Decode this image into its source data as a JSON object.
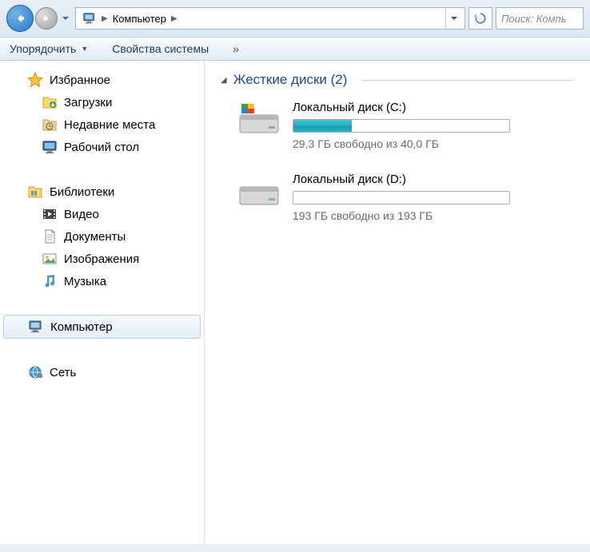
{
  "nav": {
    "location": "Компьютер",
    "search_placeholder": "Поиск: Компь"
  },
  "toolbar": {
    "organize": "Упорядочить",
    "properties": "Свойства системы",
    "overflow": "»"
  },
  "sidebar": {
    "favorites": {
      "label": "Избранное",
      "downloads": "Загрузки",
      "recent": "Недавние места",
      "desktop": "Рабочий стол"
    },
    "libraries": {
      "label": "Библиотеки",
      "video": "Видео",
      "documents": "Документы",
      "pictures": "Изображения",
      "music": "Музыка"
    },
    "computer": "Компьютер",
    "network": "Сеть"
  },
  "content": {
    "section_title": "Жесткие диски (2)",
    "drives": [
      {
        "name": "Локальный диск (C:)",
        "status": "29,3 ГБ свободно из 40,0 ГБ",
        "fill_pct": 27
      },
      {
        "name": "Локальный диск (D:)",
        "status": "193 ГБ свободно из 193 ГБ",
        "fill_pct": 0
      }
    ]
  }
}
